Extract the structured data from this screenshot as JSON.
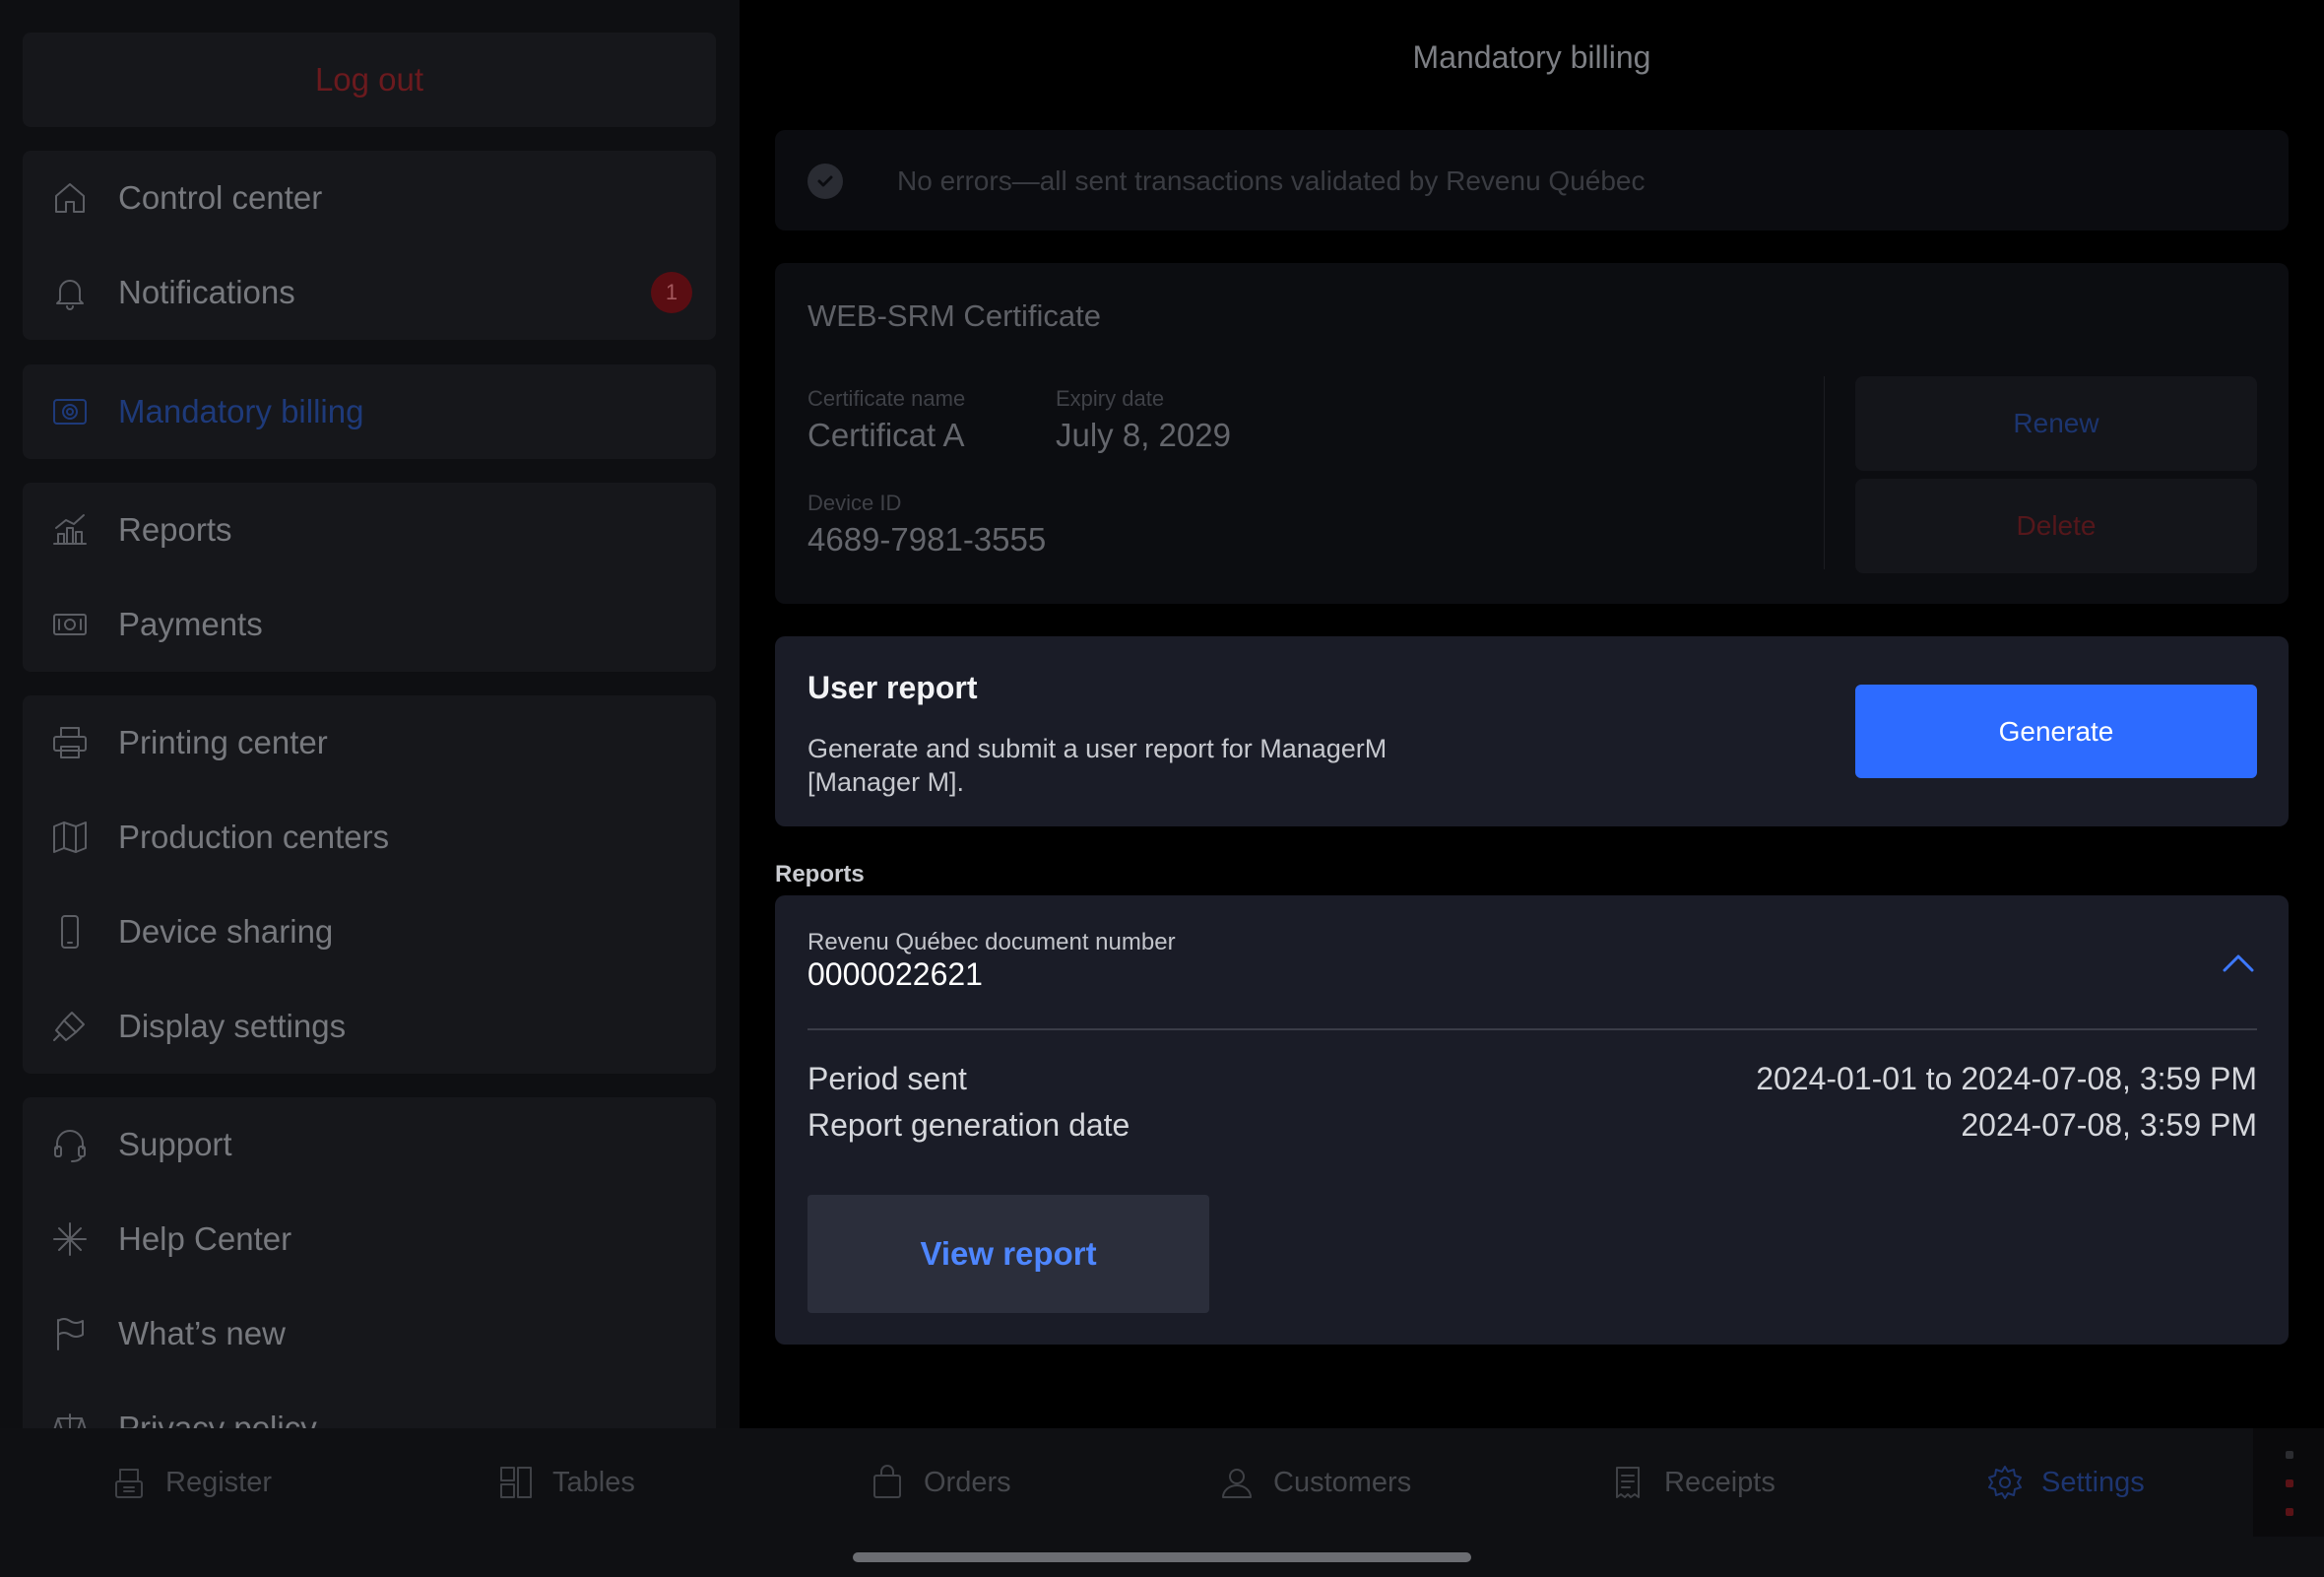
{
  "sidebar": {
    "logout_label": "Log out",
    "items": [
      {
        "label": "Control center",
        "icon": "home-icon"
      },
      {
        "label": "Notifications",
        "icon": "bell-icon",
        "badge": "1"
      },
      {
        "label": "Mandatory billing",
        "icon": "billing-icon",
        "active": true
      },
      {
        "label": "Reports",
        "icon": "chart-icon"
      },
      {
        "label": "Payments",
        "icon": "cash-icon"
      },
      {
        "label": "Printing center",
        "icon": "printer-icon"
      },
      {
        "label": "Production centers",
        "icon": "map-icon"
      },
      {
        "label": "Device sharing",
        "icon": "phone-icon"
      },
      {
        "label": "Display settings",
        "icon": "brush-icon"
      },
      {
        "label": "Support",
        "icon": "headset-icon"
      },
      {
        "label": "Help Center",
        "icon": "sparkle-icon"
      },
      {
        "label": "What’s new",
        "icon": "flag-icon"
      },
      {
        "label": "Privacy policy",
        "icon": "scale-icon"
      }
    ]
  },
  "main": {
    "title": "Mandatory billing",
    "status": {
      "text": "No errors—all sent transactions validated by Revenu Québec",
      "icon": "check-circle-icon"
    },
    "certificate": {
      "title": "WEB-SRM Certificate",
      "name_label": "Certificate name",
      "name_value": "Certificat A",
      "expiry_label": "Expiry date",
      "expiry_value": "July 8, 2029",
      "device_label": "Device ID",
      "device_value": "4689-7981-3555",
      "renew_label": "Renew",
      "delete_label": "Delete"
    },
    "user_report": {
      "title": "User report",
      "description": "Generate and submit a user report for ManagerM [Manager M].",
      "generate_label": "Generate"
    },
    "reports_section_label": "Reports",
    "report": {
      "doc_label": "Revenu Québec document number",
      "doc_number": "0000022621",
      "period_label": "Period sent",
      "period_value": "2024-01-01 to 2024-07-08, 3:59 PM",
      "generation_label": "Report generation date",
      "generation_value": "2024-07-08, 3:59 PM",
      "view_label": "View report"
    }
  },
  "tabbar": {
    "tabs": [
      {
        "label": "Register",
        "icon": "register-icon"
      },
      {
        "label": "Tables",
        "icon": "tables-icon"
      },
      {
        "label": "Orders",
        "icon": "bag-icon"
      },
      {
        "label": "Customers",
        "icon": "user-icon"
      },
      {
        "label": "Receipts",
        "icon": "receipt-icon"
      },
      {
        "label": "Settings",
        "icon": "gear-icon",
        "active": true
      }
    ]
  },
  "colors": {
    "accent": "#2d6bff",
    "danger": "#6b1a1e",
    "card": "#1a1c27",
    "background": "#000000"
  }
}
